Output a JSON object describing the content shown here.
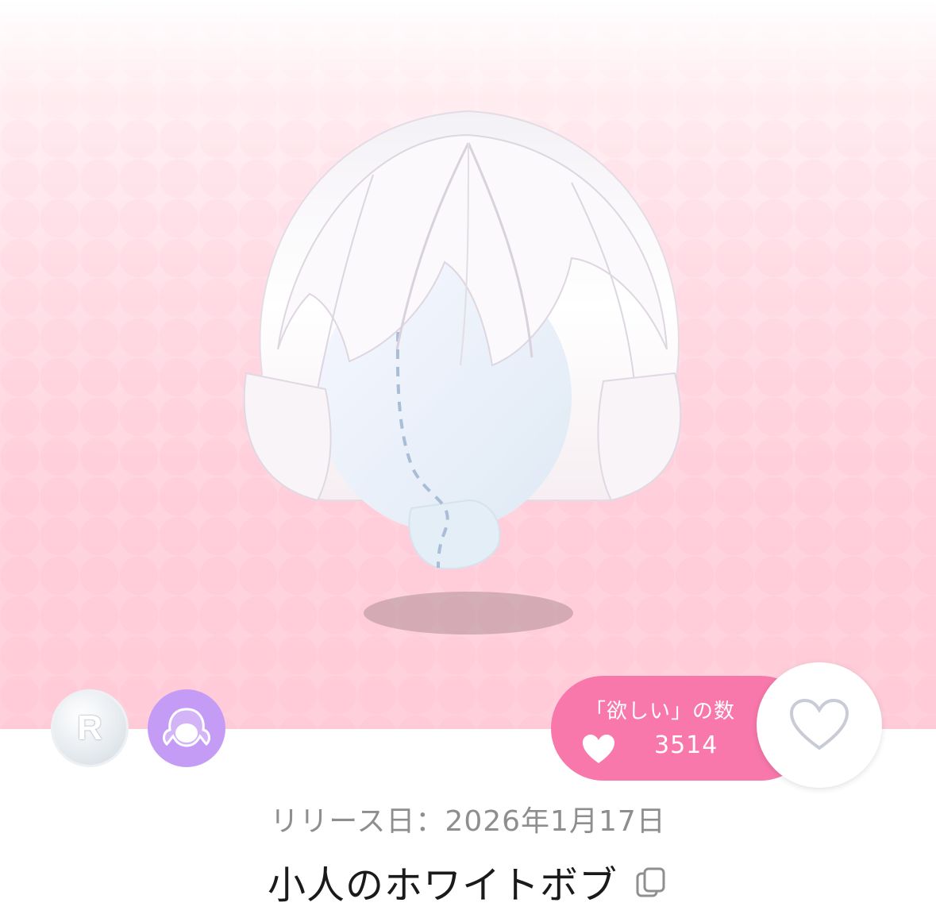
{
  "item": {
    "name": "小人のホワイトボブ",
    "release_date": "リリース日：2026年1月17日",
    "rarity_badge": "R",
    "category_icon": "hair-category-icon"
  },
  "want": {
    "label": "「欲しい」の数",
    "count": "3514"
  },
  "icons": {
    "like": "heart-outline-icon",
    "copy": "copy-icon",
    "want": "heart-filled-icon"
  },
  "colors": {
    "accent_pink": "#f878ab",
    "category_purple": "#c59cf5",
    "background_pink": "#ffd4de"
  }
}
